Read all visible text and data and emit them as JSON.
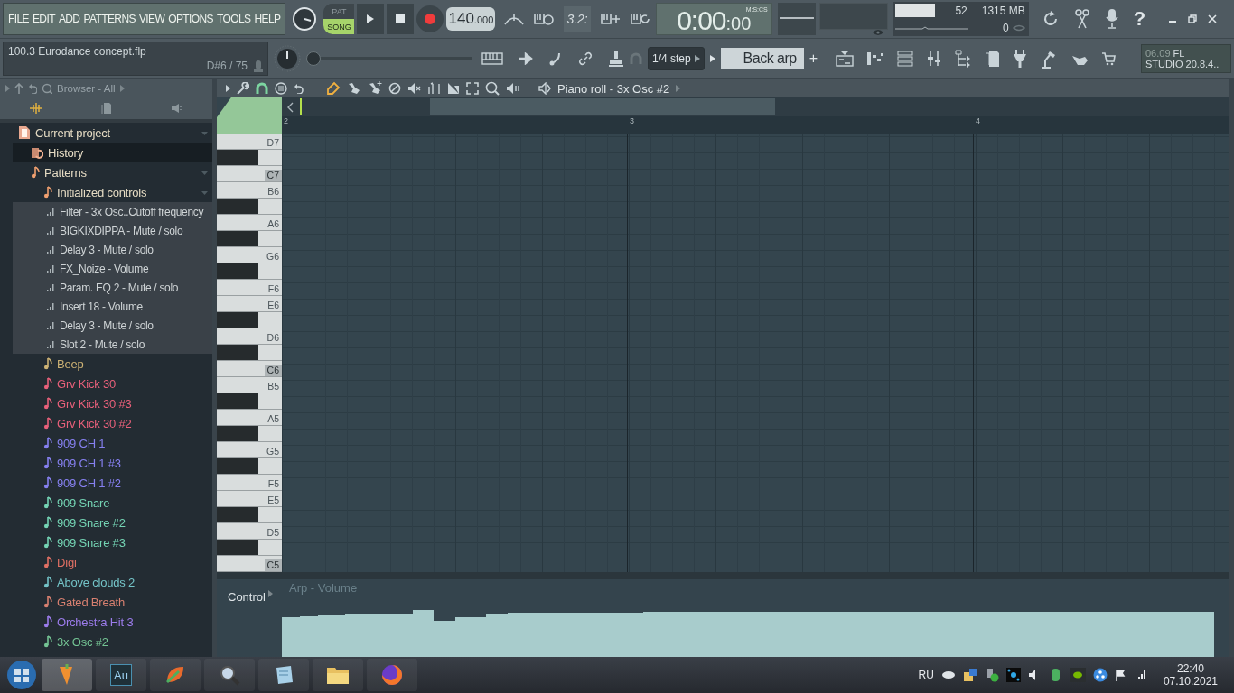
{
  "menu": [
    "FILE",
    "EDIT",
    "ADD",
    "PATTERNS",
    "VIEW",
    "OPTIONS",
    "TOOLS",
    "HELP"
  ],
  "project": {
    "file": "100.3 Eurodance concept.flp",
    "hint": "D#6 / 75"
  },
  "transport": {
    "modes": [
      {
        "label": "PAT",
        "selected": false
      },
      {
        "label": "SONG",
        "selected": true
      }
    ],
    "tempo": "140",
    "tempo_fraction": ".000"
  },
  "master_slider": {
    "level": 0
  },
  "typing_button": "3.2:",
  "time": {
    "value": "0:00",
    "centiseconds": ":00",
    "format": "M:S:CS"
  },
  "cpu": {
    "level": 0.55,
    "polyphony": "52",
    "memory": "1315 MB",
    "voices": "0"
  },
  "help": "?",
  "snap": "1/4 step",
  "pattern": "Back arp",
  "add": "+",
  "version": {
    "time": "06.09",
    "brand": "FL",
    "edition": "STUDIO 20.8.4.."
  },
  "browser": {
    "title": "Browser - All",
    "tree": [
      {
        "label": "Current project",
        "kind": "project",
        "expanded": true,
        "children": [
          {
            "label": "History",
            "kind": "history"
          },
          {
            "label": "Patterns",
            "kind": "folder",
            "expanded": true,
            "children": [
              {
                "label": "Initialized controls",
                "kind": "folder",
                "expanded": true,
                "children": [
                  {
                    "label": "Filter - 3x Osc..Cutoff frequency",
                    "kind": "automation"
                  },
                  {
                    "label": "BIGKIXDIPPA - Mute / solo",
                    "kind": "automation"
                  },
                  {
                    "label": "Delay 3 - Mute / solo",
                    "kind": "automation"
                  },
                  {
                    "label": "FX_Noize - Volume",
                    "kind": "automation"
                  },
                  {
                    "label": "Param. EQ 2 - Mute / solo",
                    "kind": "automation"
                  },
                  {
                    "label": "Insert 18 - Volume",
                    "kind": "automation"
                  },
                  {
                    "label": "Delay 3 - Mute / solo",
                    "kind": "automation"
                  },
                  {
                    "label": "Slot 2 - Mute / solo",
                    "kind": "automation"
                  }
                ]
              },
              {
                "label": "Beep",
                "kind": "pattern",
                "color": "#cdb274"
              },
              {
                "label": "Grv Kick 30",
                "kind": "pattern",
                "color": "#e8607a"
              },
              {
                "label": "Grv Kick 30 #3",
                "kind": "pattern",
                "color": "#e8607a"
              },
              {
                "label": "Grv Kick 30 #2",
                "kind": "pattern",
                "color": "#e8607a"
              },
              {
                "label": "909 CH 1",
                "kind": "pattern",
                "color": "#8680f0"
              },
              {
                "label": "909 CH 1 #3",
                "kind": "pattern",
                "color": "#8680f0"
              },
              {
                "label": "909 CH 1 #2",
                "kind": "pattern",
                "color": "#8680f0"
              },
              {
                "label": "909 Snare",
                "kind": "pattern",
                "color": "#74d4b4"
              },
              {
                "label": "909 Snare #2",
                "kind": "pattern",
                "color": "#74d4b4"
              },
              {
                "label": "909 Snare #3",
                "kind": "pattern",
                "color": "#74d4b4"
              },
              {
                "label": "Digi",
                "kind": "pattern",
                "color": "#e07064"
              },
              {
                "label": "Above clouds 2",
                "kind": "pattern",
                "color": "#74c4c8"
              },
              {
                "label": "Gated Breath",
                "kind": "pattern",
                "color": "#d88070"
              },
              {
                "label": "Orchestra Hit 3",
                "kind": "pattern",
                "color": "#9c7cec"
              },
              {
                "label": "3x Osc #2",
                "kind": "pattern",
                "color": "#74c494"
              }
            ]
          }
        ]
      }
    ]
  },
  "piano_roll": {
    "title": "Piano roll - 3x Osc #2",
    "bars": [
      "2",
      "3",
      "4"
    ],
    "keys": [
      "D7",
      "C7",
      "B6",
      "A6",
      "G6",
      "F6",
      "E6",
      "D6",
      "C6",
      "B5",
      "A5",
      "G5",
      "F5",
      "E5",
      "D5",
      "C5"
    ],
    "control": {
      "label": "Control",
      "target": "Arp - Volume"
    }
  },
  "taskbar": {
    "app_label": "Au",
    "language": "RU",
    "time": "22:40",
    "date": "07.10.2021"
  }
}
